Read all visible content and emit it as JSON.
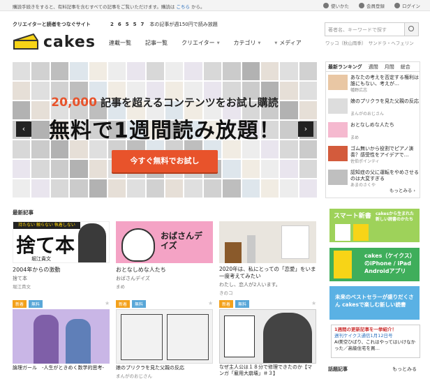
{
  "topbar": {
    "notice": "購読手続きをすると、有料記事を含むすべての記事をご覧いただけます。購読は",
    "notice_link": "こちら",
    "notice_tail": "から。",
    "links": [
      {
        "label": "使いかた",
        "icon": "help-icon"
      },
      {
        "label": "会員登録",
        "icon": "user-icon"
      },
      {
        "label": "ログイン",
        "icon": "lock-icon"
      }
    ]
  },
  "header": {
    "tagline": "クリエイターと読者をつなぐサイト",
    "logo": "cakes",
    "count_num": "26557",
    "count_text": "本の記事が週150円で読み放題",
    "nav": [
      "連載一覧",
      "記事一覧",
      "クリエイター",
      "カテゴリ",
      "メディア"
    ],
    "search_placeholder": "著者名、キーワードで探す",
    "search_keywords": "ワッコ（秋山雨季）　サンドラ・ヘフェリン"
  },
  "hero": {
    "line1_num": "20,000",
    "line1_text": "記事を超えるコンテンツをお試し購読",
    "line2": "無料で1週間読み放題！",
    "cta": "今すぐ無料でお試し",
    "prev": "‹",
    "next": "›"
  },
  "ranking": {
    "tabs": [
      "最新ランキング",
      "週間",
      "月間",
      "総合"
    ],
    "items": [
      {
        "title": "あなたの考えを否定する権利は誰にもない、考えが…",
        "author": "幡野広志"
      },
      {
        "title": "娘のプリクラを見た父親の反応",
        "author": "まんがのおじさん"
      },
      {
        "title": "おとなしめな人たち",
        "author": "まめ"
      },
      {
        "title": "ゴム無いから役割でピアノ演奏？感受性をアイデアで…",
        "author": "佐伯ポインティ"
      },
      {
        "title": "認知症の父に運転をやめさせるのは大変すぎる",
        "author": "あまのさくや"
      }
    ],
    "more": "もっとみる"
  },
  "latest": {
    "heading": "最新記事",
    "cards": [
      {
        "title": "2004年からの激動",
        "series": "捨て本",
        "author": "堀江貴文",
        "image_text": "捨て本",
        "image_sub": "堀江貴文",
        "image_top": "持たない 頼らない 執着しない"
      },
      {
        "title": "おとなしめな人たち",
        "series": "おばさんデイズ",
        "author": "まめ",
        "image_text": "おばさんデイズ"
      },
      {
        "title": "2020年は、私にとっての「恋愛」をいま一度考えてみたい",
        "series": "わたし、恋人が2人います。",
        "author": "きのコ"
      }
    ],
    "badge_new": "新着",
    "badge_free": "無料",
    "cards2": [
      {
        "title": "論理ガール　-人生がときめく数学的思考-",
        "author": ""
      },
      {
        "title": "娘のプリクラを見た父親の反応",
        "author": "まんがのおじさん"
      },
      {
        "title": "なぜ主人公は１８分で修理できたのか【マンガ「雇用大崩壊」＃３】",
        "author": ""
      }
    ]
  },
  "ads": [
    {
      "title": "スマート新書",
      "sub": "cakesから生まれた新しい読書のかたち"
    },
    {
      "title": "cakes（ケイクス）のiPhone / iPad Androidアプリ"
    },
    {
      "title": "未来のベストセラーが盛りだくさん cakesで楽しむ新しい読書"
    }
  ],
  "updates": {
    "h": "1週間の更新記事を一挙紹介！",
    "sub": "週刊ケイクス通信1月12日号",
    "line": "AI美空ひばり、これはやってはいけなかった／高級住宅を買…"
  },
  "bottom": {
    "left": "話題記事",
    "right": "もっとみる"
  },
  "colors": {
    "accent": "#e8532b",
    "logo_yellow": "#f7d417",
    "badge_new": "#f3a11b",
    "badge_free": "#59a7d8"
  }
}
